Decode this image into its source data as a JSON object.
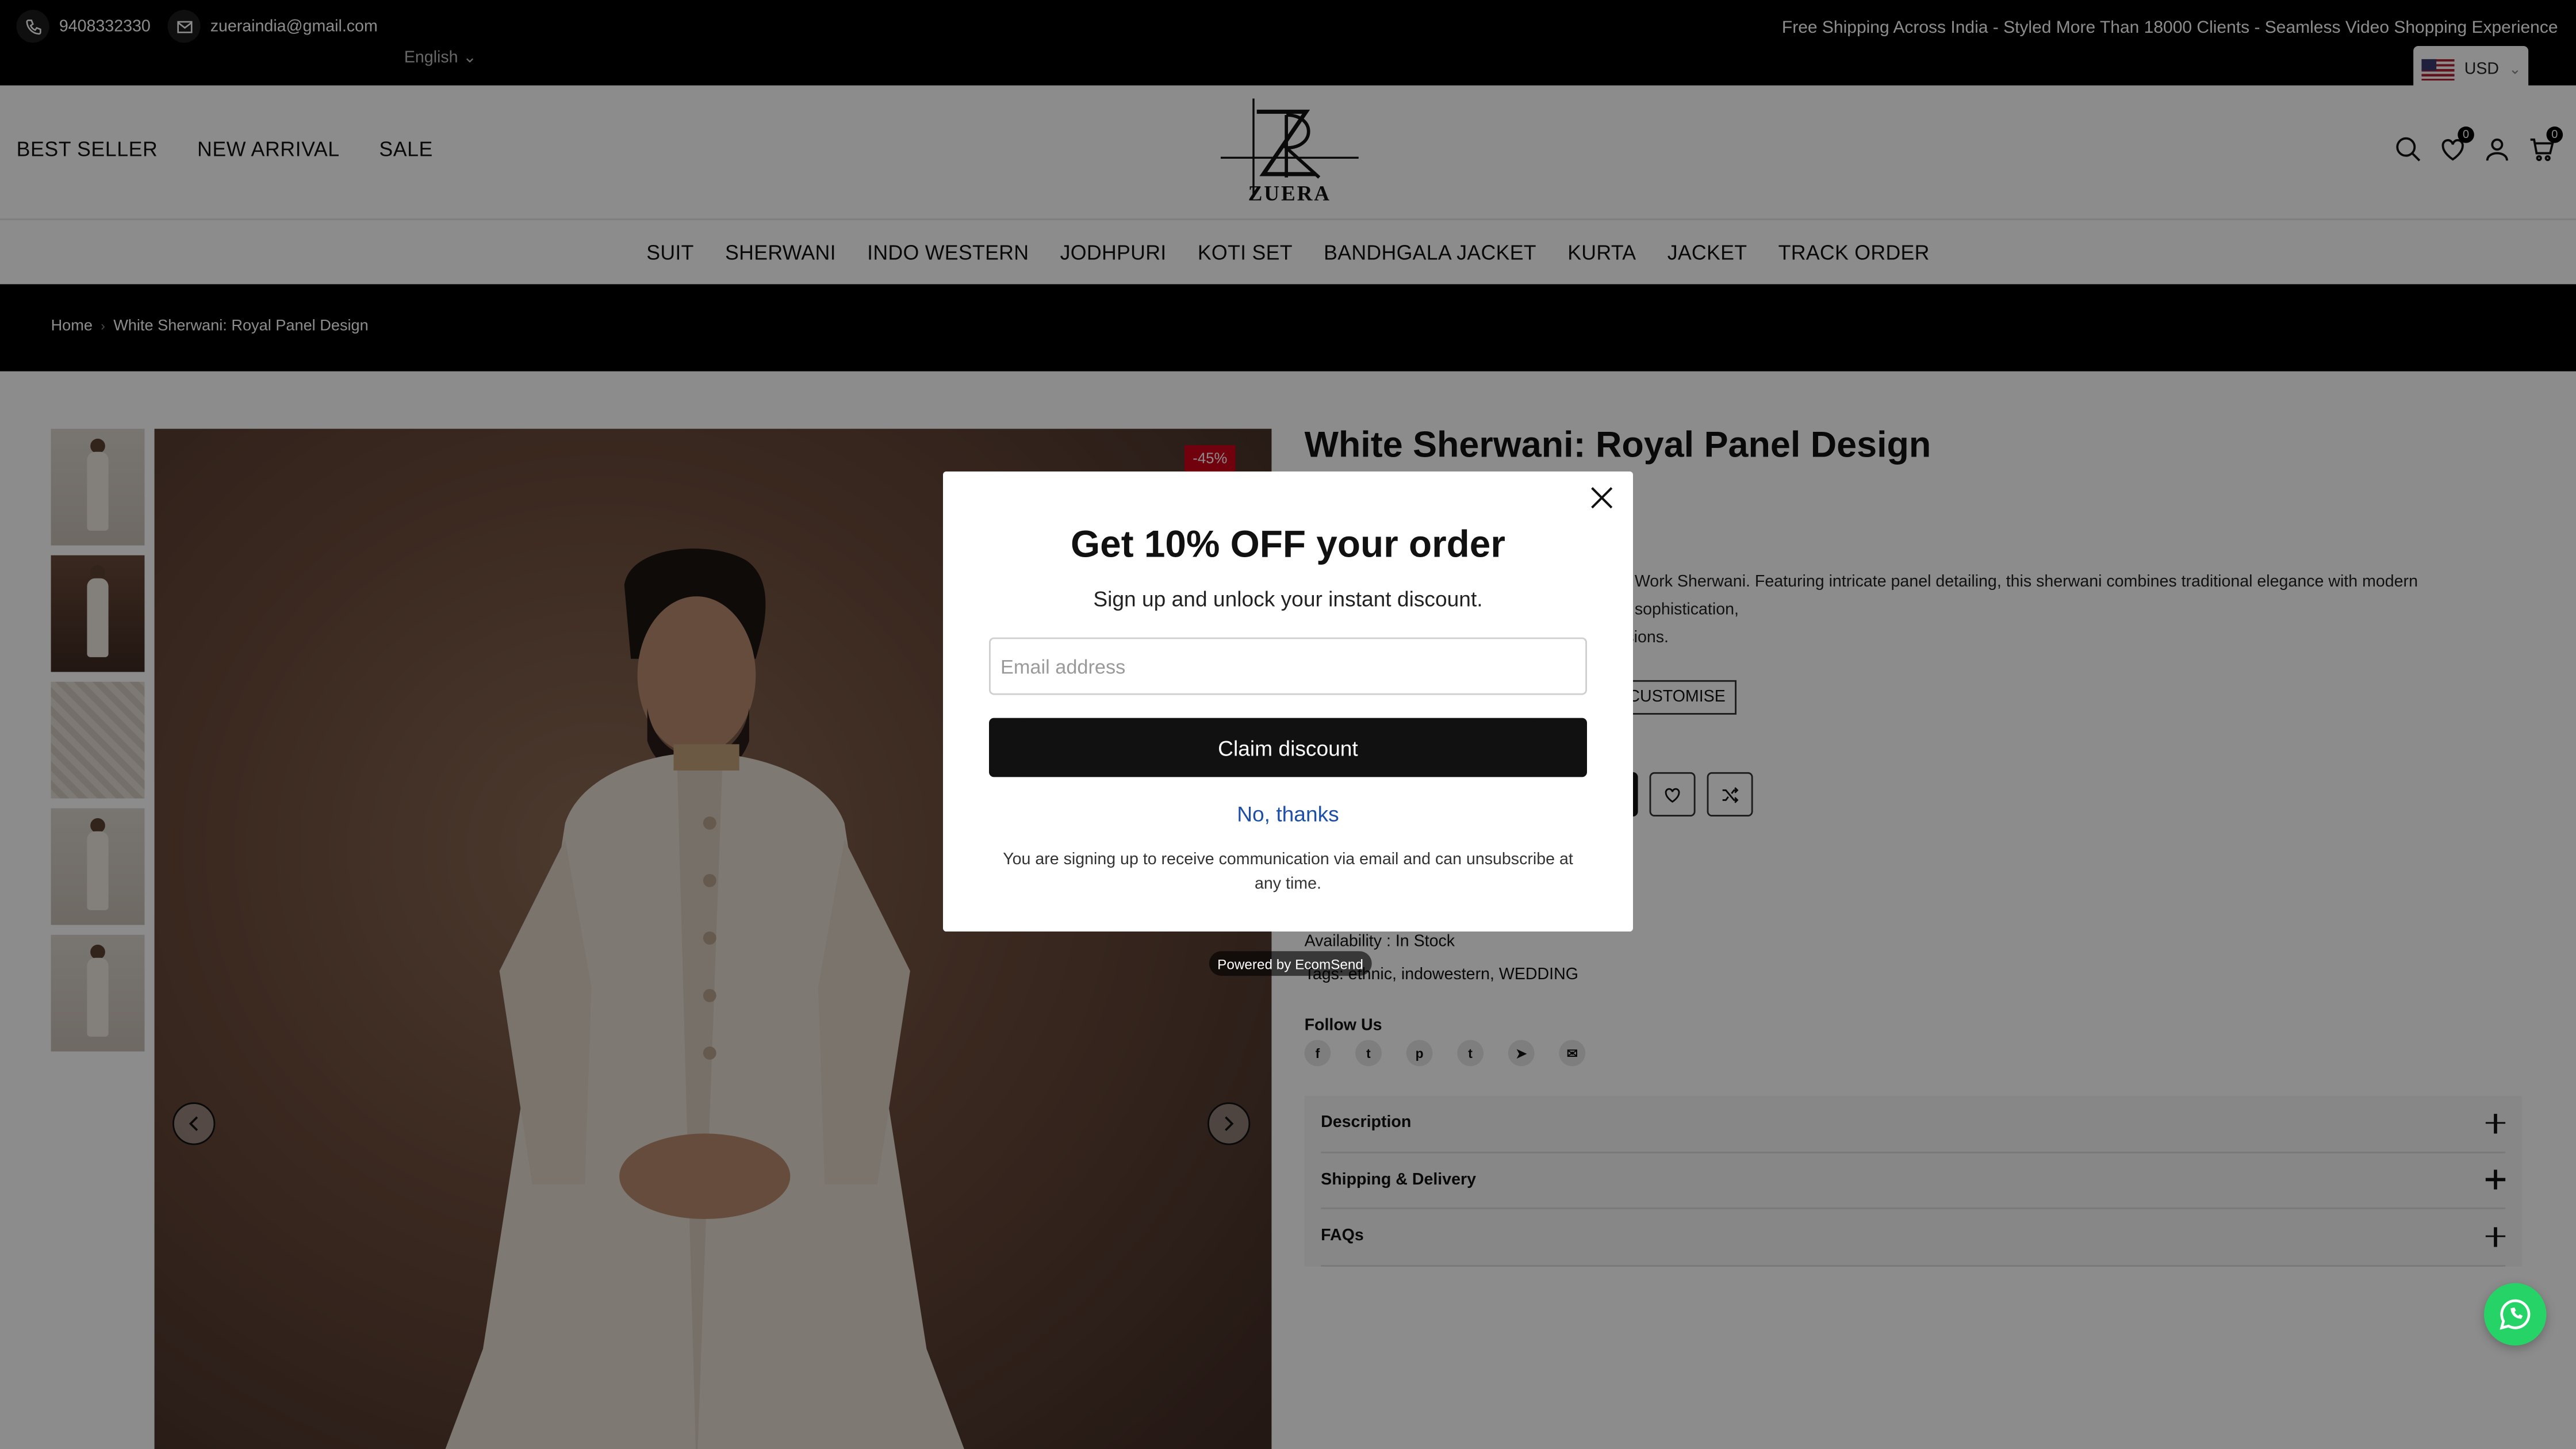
{
  "topbar": {
    "phone": "9408332330",
    "email": "zueraindia@gmail.com",
    "language": "English",
    "tagline": "Free Shipping Across India - Styled More Than 18000 Clients - Seamless Video Shopping Experience",
    "currency": "USD"
  },
  "header": {
    "left_nav": [
      "BEST SELLER",
      "NEW ARRIVAL",
      "SALE"
    ],
    "logo_text": "ZUERA",
    "wishlist_count": "0",
    "cart_count": "0"
  },
  "category_nav": [
    "SUIT",
    "SHERWANI",
    "INDO WESTERN",
    "JODHPURI",
    "KOTI SET",
    "BANDHGALA JACKET",
    "KURTA",
    "JACKET",
    "TRACK ORDER"
  ],
  "breadcrumb": {
    "home": "Home",
    "current": "White Sherwani: Royal Panel Design"
  },
  "product": {
    "title": "White Sherwani: Royal Panel Design",
    "discount_badge": "-45%",
    "description_visible": "Work Sherwani. Featuring intricate panel detailing, this sherwani combines traditional elegance with modern sophistication,",
    "description_visible_2": "asions.",
    "size_option": "CUSTOMISE",
    "availability": "Availability : In Stock",
    "tags": "Tags: ethnic, indowestern, WEDDING",
    "follow_label": "Follow Us",
    "socials": [
      "facebook",
      "twitter",
      "pinterest",
      "tumblr",
      "telegram",
      "email"
    ],
    "accordion": [
      "Description",
      "Shipping & Delivery",
      "FAQs"
    ]
  },
  "popup": {
    "title": "Get 10% OFF your order",
    "subtitle": "Sign up and unlock your instant discount.",
    "email_placeholder": "Email address",
    "claim_label": "Claim discount",
    "decline_label": "No, thanks",
    "legal": "You are signing up to receive communication via email and can unsubscribe at any time.",
    "powered_by": "Powered by EcomSend"
  },
  "colors": {
    "sale_red": "#d0021b",
    "whatsapp_green": "#25d366",
    "link_blue": "#1d4fa8"
  }
}
